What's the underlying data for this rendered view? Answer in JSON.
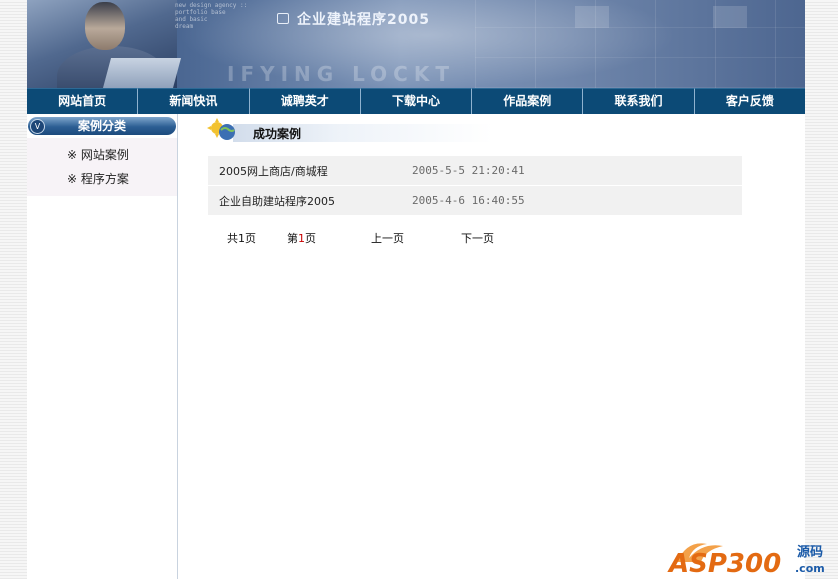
{
  "banner": {
    "title": "企业建站程序2005",
    "tagline_lines": [
      "new design agency ::",
      "portfolio base",
      "and basic",
      "dream"
    ],
    "ghost_text": "IFYING LOCKT"
  },
  "nav": {
    "items": [
      {
        "label": "网站首页"
      },
      {
        "label": "新闻快讯"
      },
      {
        "label": "诚聘英才"
      },
      {
        "label": "下载中心"
      },
      {
        "label": "作品案例"
      },
      {
        "label": "联系我们"
      },
      {
        "label": "客户反馈"
      }
    ]
  },
  "sidebar": {
    "heading": "案例分类",
    "collapse_glyph": "V",
    "items": [
      {
        "label": "※ 网站案例"
      },
      {
        "label": "※ 程序方案"
      }
    ]
  },
  "main": {
    "title": "成功案例",
    "rows": [
      {
        "name": "2005网上商店/商城程",
        "date": "2005-5-5 21:20:41"
      },
      {
        "name": "企业自助建站程序2005",
        "date": "2005-4-6 16:40:55"
      }
    ],
    "pager": {
      "total_prefix": "共",
      "total_pages": "1",
      "total_suffix": "页",
      "current_prefix": "第",
      "current_page": "1",
      "current_suffix": "页",
      "prev_label": "上一页",
      "next_label": "下一页"
    }
  },
  "watermark": {
    "brand": "ASP300",
    "suffix": "源码",
    "domain": ".com"
  },
  "colors": {
    "nav_bg": "#0c4a76",
    "row_bg": "#f1f1f1",
    "accent_red": "#c80000"
  }
}
